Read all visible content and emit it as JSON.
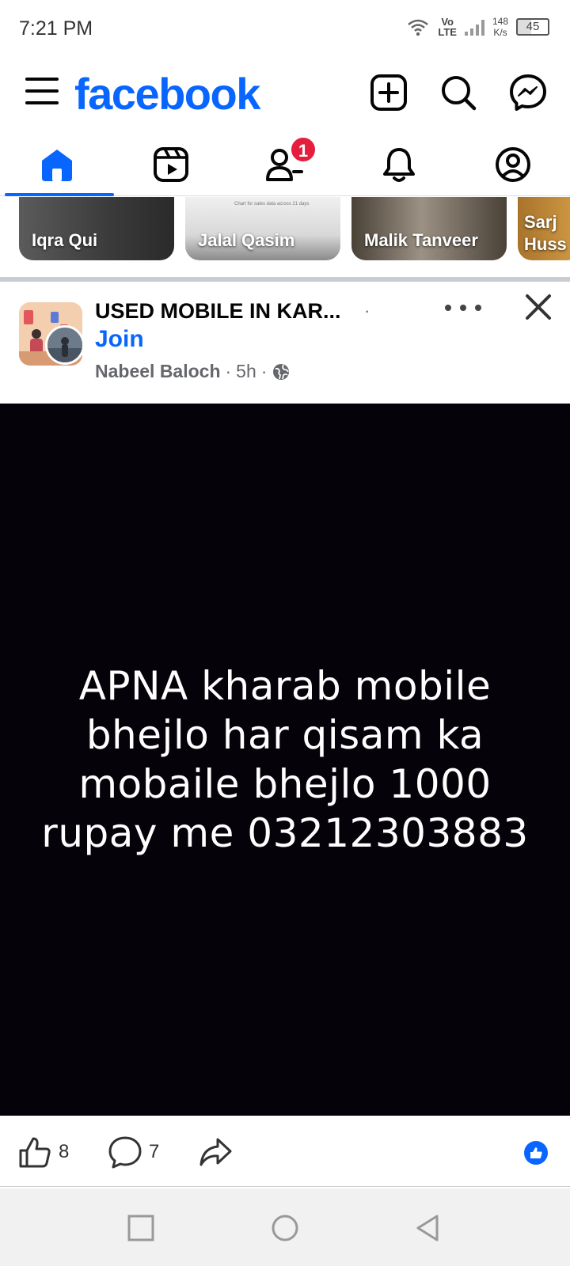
{
  "status_bar": {
    "time": "7:21 PM",
    "network_top": "Vo",
    "network_bottom": "LTE",
    "speed_value": "148",
    "speed_unit": "K/s",
    "battery": "45"
  },
  "header": {
    "logo": "facebook",
    "icons": [
      "create-icon",
      "search-icon",
      "messenger-icon"
    ],
    "brand_color": "#0866ff"
  },
  "tabs": [
    {
      "name": "home",
      "active": true
    },
    {
      "name": "reels",
      "active": false
    },
    {
      "name": "friends",
      "active": false,
      "badge": "1"
    },
    {
      "name": "notifications",
      "active": false
    },
    {
      "name": "profile",
      "active": false
    }
  ],
  "stories": [
    {
      "name": "Iqra Qui"
    },
    {
      "name": "Jalal Qasim",
      "caption": "Chart for sales data across 21 days"
    },
    {
      "name": "Malik Tanveer"
    },
    {
      "name": "Sarj Huss"
    }
  ],
  "post": {
    "group_name": "USED MOBILE IN KAR...",
    "separator": "·",
    "join_label": "Join",
    "author": "Nabeel Baloch",
    "time": "5h",
    "audience_icon": "globe-icon",
    "text": "APNA kharab mobile bhejlo har qisam ka mobaile bhejlo 1000 rupay me 03212303883",
    "likes": "8",
    "comments": "7"
  },
  "nav_bar": {
    "buttons": [
      "recents-button",
      "home-button",
      "back-button"
    ]
  }
}
